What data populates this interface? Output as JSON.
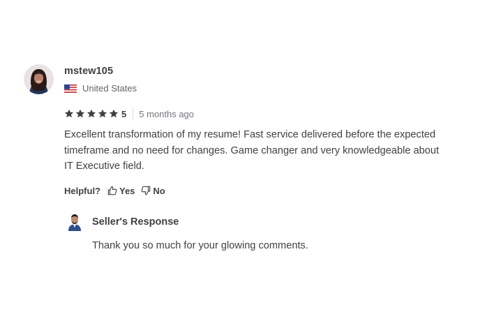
{
  "review": {
    "username": "mstew105",
    "country": "United States",
    "flag_icon": "us-flag-icon",
    "rating": "5",
    "rating_stars": 5,
    "date": "5 months ago",
    "text": "Excellent transformation of my resume! Fast service delivered before the expected timeframe and no need for changes. Game changer and very knowledgeable about IT Executive field.",
    "helpful": {
      "label": "Helpful?",
      "yes_label": "Yes",
      "no_label": "No"
    }
  },
  "seller_response": {
    "title": "Seller's Response",
    "text": "Thank you so much for your glowing comments."
  },
  "colors": {
    "text": "#404145",
    "secondary_text": "#74767e",
    "star": "#404145"
  }
}
